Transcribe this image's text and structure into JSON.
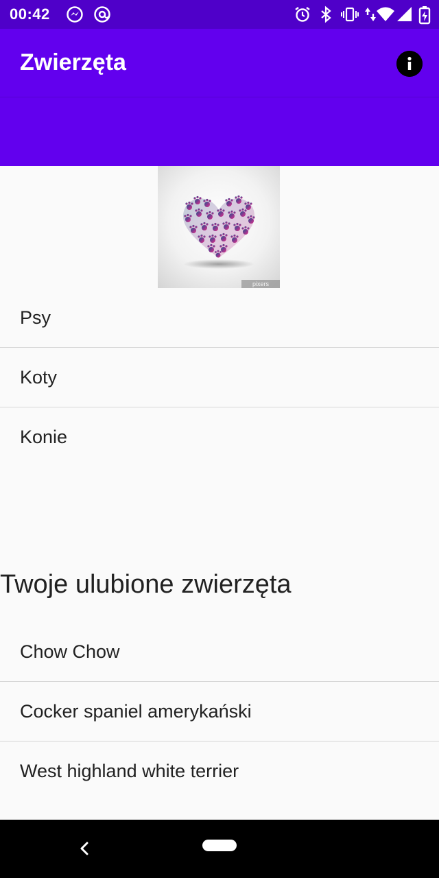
{
  "status_bar": {
    "time": "00:42",
    "icons_left": [
      "messenger-icon",
      "at-sign-icon"
    ],
    "icons_right": [
      "alarm-icon",
      "bluetooth-icon",
      "vibrate-icon",
      "data-arrows-icon",
      "wifi-icon",
      "cellular-signal-icon",
      "battery-charging-icon"
    ]
  },
  "app_bar": {
    "title": "Zwierzęta",
    "action_icon": "info-icon",
    "color": "#6200ee",
    "status_color": "#4f00c9"
  },
  "hero_image": {
    "description_icon": "paw-heart-image",
    "watermark": "pixers"
  },
  "categories": [
    {
      "label": "Psy"
    },
    {
      "label": "Koty"
    },
    {
      "label": "Konie"
    }
  ],
  "favorites": {
    "title": "Twoje ulubione zwierzęta",
    "items": [
      {
        "label": "Chow Chow"
      },
      {
        "label": "Cocker spaniel amerykański"
      },
      {
        "label": "West highland white terrier"
      }
    ]
  },
  "nav_bar": {
    "back_icon": "back-chevron-icon",
    "home_icon": "home-pill-icon"
  }
}
